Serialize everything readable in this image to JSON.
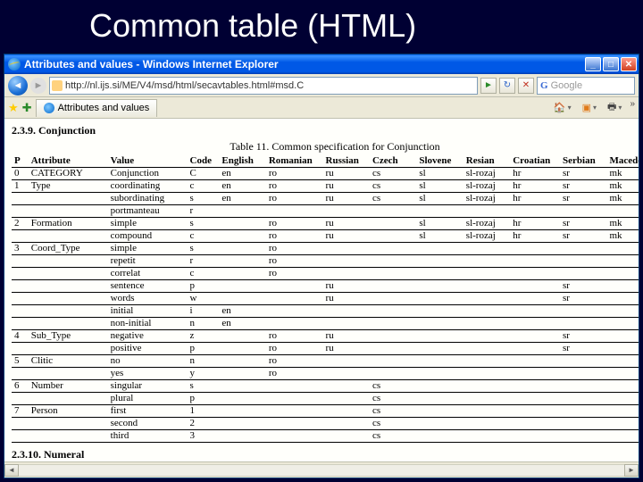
{
  "slide": {
    "title": "Common table (HTML)"
  },
  "window": {
    "title": "Attributes and values - Windows Internet Explorer",
    "url": "http://nl.ijs.si/ME/V4/msd/html/secavtables.html#msd.C",
    "search_placeholder": "Google",
    "tab_label": "Attributes and values"
  },
  "page": {
    "section_heading": "2.3.9. Conjunction",
    "next_section": "2.3.10. Numeral",
    "table_caption": "Table 11. Common specification for Conjunction"
  },
  "columns": [
    "P",
    "Attribute",
    "Value",
    "Code",
    "English",
    "Romanian",
    "Russian",
    "Czech",
    "Slovene",
    "Resian",
    "Croatian",
    "Serbian",
    "Macedon"
  ],
  "rows": [
    {
      "p": "0",
      "attr": "CATEGORY",
      "val": "Conjunction",
      "code": "C",
      "langs": [
        "en",
        "ro",
        "ru",
        "cs",
        "sl",
        "sl-rozaj",
        "hr",
        "sr",
        "mk"
      ]
    },
    {
      "p": "1",
      "attr": "Type",
      "val": "coordinating",
      "code": "c",
      "langs": [
        "en",
        "ro",
        "ru",
        "cs",
        "sl",
        "sl-rozaj",
        "hr",
        "sr",
        "mk"
      ]
    },
    {
      "p": "",
      "attr": "",
      "val": "subordinating",
      "code": "s",
      "langs": [
        "en",
        "ro",
        "ru",
        "cs",
        "sl",
        "sl-rozaj",
        "hr",
        "sr",
        "mk"
      ]
    },
    {
      "p": "",
      "attr": "",
      "val": "portmanteau",
      "code": "r",
      "langs": [
        "",
        "",
        "",
        "",
        "",
        "",
        "",
        "",
        ""
      ]
    },
    {
      "p": "2",
      "attr": "Formation",
      "val": "simple",
      "code": "s",
      "langs": [
        "",
        "ro",
        "ru",
        "",
        "sl",
        "sl-rozaj",
        "hr",
        "sr",
        "mk"
      ]
    },
    {
      "p": "",
      "attr": "",
      "val": "compound",
      "code": "c",
      "langs": [
        "",
        "ro",
        "ru",
        "",
        "sl",
        "sl-rozaj",
        "hr",
        "sr",
        "mk"
      ]
    },
    {
      "p": "3",
      "attr": "Coord_Type",
      "val": "simple",
      "code": "s",
      "langs": [
        "",
        "ro",
        "",
        "",
        "",
        "",
        "",
        "",
        ""
      ]
    },
    {
      "p": "",
      "attr": "",
      "val": "repetit",
      "code": "r",
      "langs": [
        "",
        "ro",
        "",
        "",
        "",
        "",
        "",
        "",
        ""
      ]
    },
    {
      "p": "",
      "attr": "",
      "val": "correlat",
      "code": "c",
      "langs": [
        "",
        "ro",
        "",
        "",
        "",
        "",
        "",
        "",
        ""
      ]
    },
    {
      "p": "",
      "attr": "",
      "val": "sentence",
      "code": "p",
      "langs": [
        "",
        "",
        "ru",
        "",
        "",
        "",
        "",
        "sr",
        ""
      ]
    },
    {
      "p": "",
      "attr": "",
      "val": "words",
      "code": "w",
      "langs": [
        "",
        "",
        "ru",
        "",
        "",
        "",
        "",
        "sr",
        ""
      ]
    },
    {
      "p": "",
      "attr": "",
      "val": "initial",
      "code": "i",
      "langs": [
        "en",
        "",
        "",
        "",
        "",
        "",
        "",
        "",
        ""
      ]
    },
    {
      "p": "",
      "attr": "",
      "val": "non-initial",
      "code": "n",
      "langs": [
        "en",
        "",
        "",
        "",
        "",
        "",
        "",
        "",
        ""
      ]
    },
    {
      "p": "4",
      "attr": "Sub_Type",
      "val": "negative",
      "code": "z",
      "langs": [
        "",
        "ro",
        "ru",
        "",
        "",
        "",
        "",
        "sr",
        ""
      ]
    },
    {
      "p": "",
      "attr": "",
      "val": "positive",
      "code": "p",
      "langs": [
        "",
        "ro",
        "ru",
        "",
        "",
        "",
        "",
        "sr",
        ""
      ]
    },
    {
      "p": "5",
      "attr": "Clitic",
      "val": "no",
      "code": "n",
      "langs": [
        "",
        "ro",
        "",
        "",
        "",
        "",
        "",
        "",
        ""
      ]
    },
    {
      "p": "",
      "attr": "",
      "val": "yes",
      "code": "y",
      "langs": [
        "",
        "ro",
        "",
        "",
        "",
        "",
        "",
        "",
        ""
      ]
    },
    {
      "p": "6",
      "attr": "Number",
      "val": "singular",
      "code": "s",
      "langs": [
        "",
        "",
        "",
        "cs",
        "",
        "",
        "",
        "",
        ""
      ]
    },
    {
      "p": "",
      "attr": "",
      "val": "plural",
      "code": "p",
      "langs": [
        "",
        "",
        "",
        "cs",
        "",
        "",
        "",
        "",
        ""
      ]
    },
    {
      "p": "7",
      "attr": "Person",
      "val": "first",
      "code": "1",
      "langs": [
        "",
        "",
        "",
        "cs",
        "",
        "",
        "",
        "",
        ""
      ]
    },
    {
      "p": "",
      "attr": "",
      "val": "second",
      "code": "2",
      "langs": [
        "",
        "",
        "",
        "cs",
        "",
        "",
        "",
        "",
        ""
      ]
    },
    {
      "p": "",
      "attr": "",
      "val": "third",
      "code": "3",
      "langs": [
        "",
        "",
        "",
        "cs",
        "",
        "",
        "",
        "",
        ""
      ]
    }
  ]
}
